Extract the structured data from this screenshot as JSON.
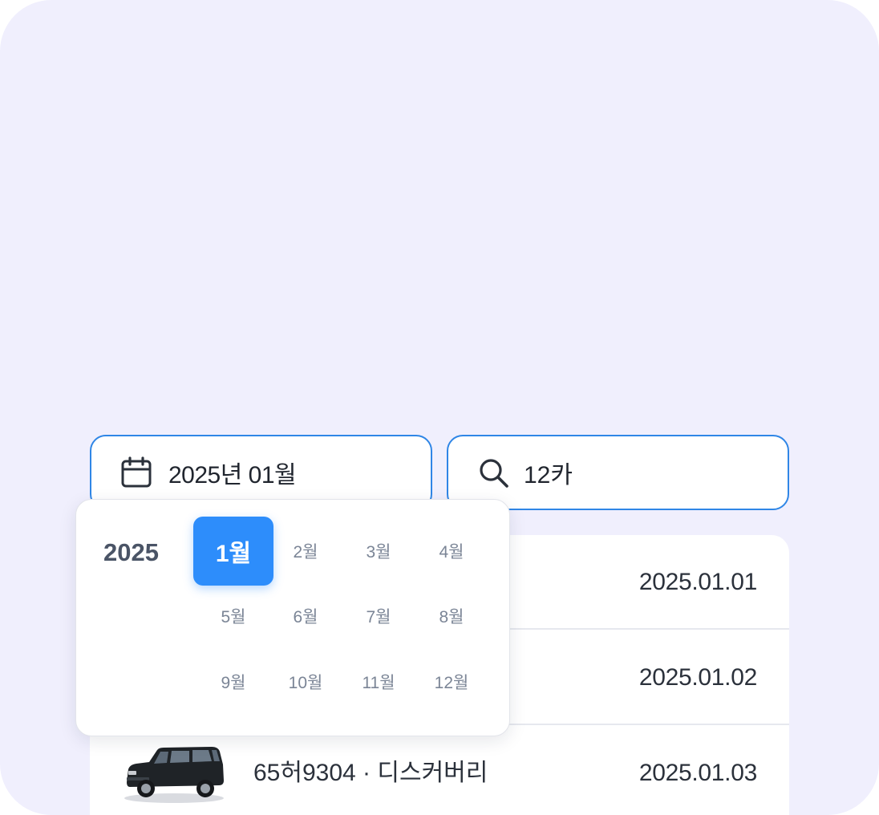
{
  "date_field": {
    "value": "2025년 01월",
    "icon": "calendar-icon"
  },
  "search_field": {
    "value": "12카",
    "icon": "search-icon"
  },
  "month_picker": {
    "year": "2025",
    "selected": "1월",
    "months": [
      "1월",
      "2월",
      "3월",
      "4월",
      "5월",
      "6월",
      "7월",
      "8월",
      "9월",
      "10월",
      "11월",
      "12월"
    ]
  },
  "rows": [
    {
      "title": "",
      "date": "2025.01.01"
    },
    {
      "title": "",
      "date": "2025.01.02"
    },
    {
      "title": "65허9304 · 디스커버리",
      "date": "2025.01.03"
    }
  ],
  "colors": {
    "background": "#f0effd",
    "accent": "#2d8dfb",
    "field_border": "#2f86e6"
  }
}
